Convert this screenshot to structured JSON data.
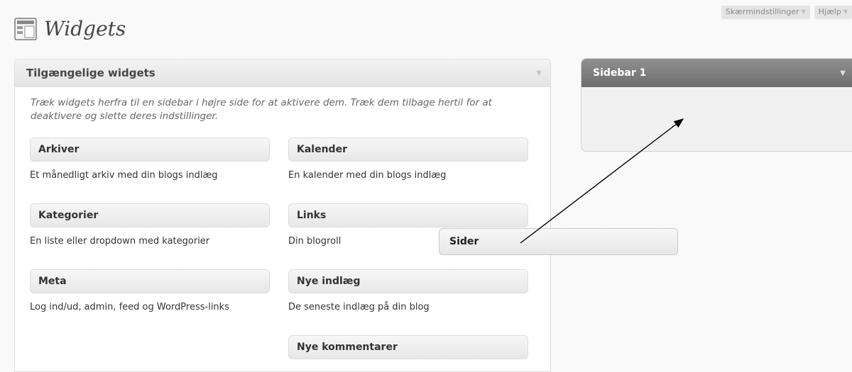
{
  "screen_meta": {
    "screen_options": "Skærmindstillinger",
    "help": "Hjælp"
  },
  "page": {
    "title": "Widgets",
    "icon": "widgets-icon"
  },
  "available": {
    "title": "Tilgængelige widgets",
    "description": "Træk widgets herfra til en sidebar i højre side for at aktivere dem. Træk dem tilbage hertil for at deaktivere og slette deres indstillinger.",
    "widgets": [
      {
        "name": "Arkiver",
        "desc": "Et månedligt arkiv med din blogs indlæg"
      },
      {
        "name": "Kalender",
        "desc": "En kalender med din blogs indlæg"
      },
      {
        "name": "Kategorier",
        "desc": "En liste eller dropdown med kategorier"
      },
      {
        "name": "Links",
        "desc": "Din blogroll"
      },
      {
        "name": "Meta",
        "desc": "Log ind/ud, admin, feed og WordPress-links"
      },
      {
        "name": "Nye indlæg",
        "desc": "De seneste indlæg på din blog"
      },
      {
        "name": "Nye kommentarer",
        "desc": ""
      }
    ]
  },
  "dragging_widget": {
    "name": "Sider"
  },
  "sidebar": {
    "title": "Sidebar 1"
  },
  "colors": {
    "sidebar_header": "#787878",
    "background": "#f9f9f9"
  }
}
